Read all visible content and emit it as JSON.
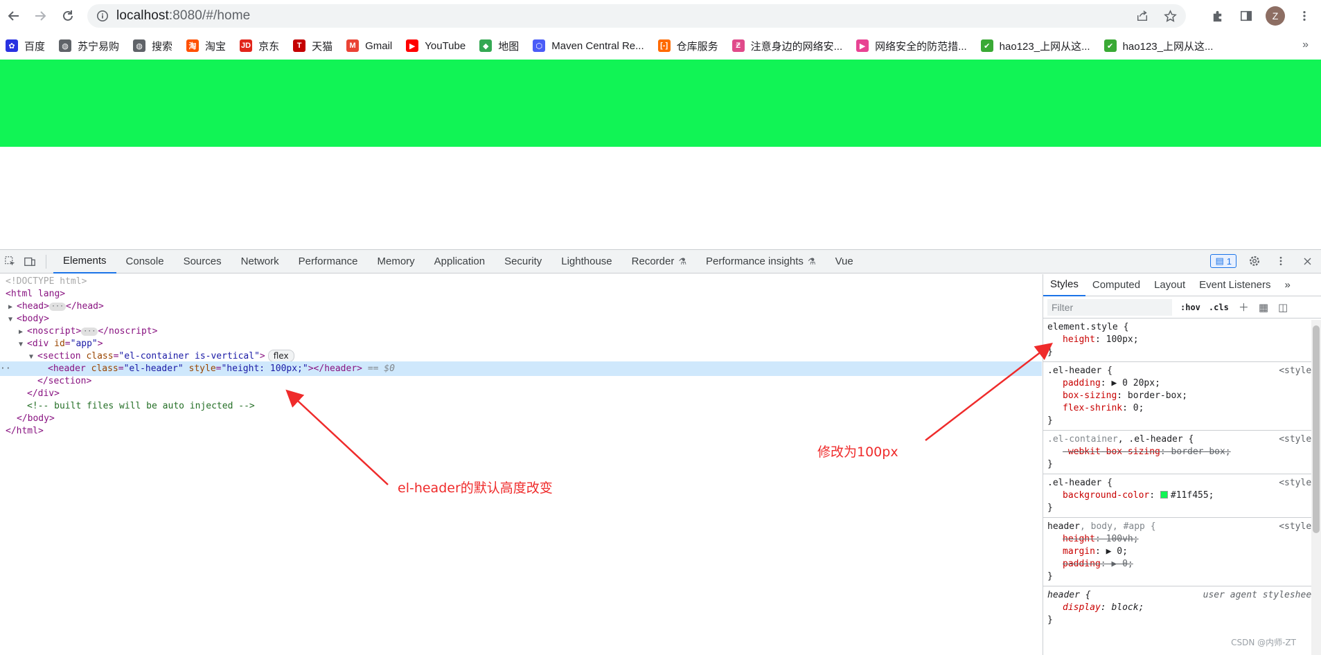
{
  "browser": {
    "url_host": "localhost",
    "url_rest": ":8080/#/home",
    "avatar_initial": "Z"
  },
  "bookmarks": [
    {
      "label": "百度",
      "icon": "baidu-icon",
      "color": "#2932e1",
      "glyph": "✿"
    },
    {
      "label": "苏宁易购",
      "icon": "globe-icon",
      "color": "#5f6368",
      "glyph": "◍"
    },
    {
      "label": "搜索",
      "icon": "globe-icon",
      "color": "#5f6368",
      "glyph": "◍"
    },
    {
      "label": "淘宝",
      "icon": "taobao-icon",
      "color": "#ff5000",
      "glyph": "淘"
    },
    {
      "label": "京东",
      "icon": "jd-icon",
      "color": "#e1251b",
      "glyph": "JD"
    },
    {
      "label": "天猫",
      "icon": "tmall-icon",
      "color": "#c40000",
      "glyph": "T"
    },
    {
      "label": "Gmail",
      "icon": "gmail-icon",
      "color": "#ea4335",
      "glyph": "M"
    },
    {
      "label": "YouTube",
      "icon": "youtube-icon",
      "color": "#ff0000",
      "glyph": "▶"
    },
    {
      "label": "地图",
      "icon": "maps-icon",
      "color": "#34a853",
      "glyph": "◆"
    },
    {
      "label": "Maven Central Re...",
      "icon": "maven-icon",
      "color": "#4a5cf7",
      "glyph": "⬡"
    },
    {
      "label": "仓库服务",
      "icon": "aliyun-icon",
      "color": "#ff6a00",
      "glyph": "[-]"
    },
    {
      "label": "注意身边的网络安...",
      "icon": "bilibili-icon",
      "color": "#e04a8a",
      "glyph": "Ƶ"
    },
    {
      "label": "网络安全的防范措...",
      "icon": "video-icon",
      "color": "#e84393",
      "glyph": "▶"
    },
    {
      "label": "hao123_上网从这...",
      "icon": "hao123-icon",
      "color": "#3aa935",
      "glyph": "✔"
    },
    {
      "label": "hao123_上网从这...",
      "icon": "hao123-icon",
      "color": "#3aa935",
      "glyph": "✔"
    }
  ],
  "bookmarks_more": "»",
  "header_color": "#11f455",
  "devtools": {
    "tabs": [
      {
        "label": "Elements",
        "active": true,
        "flask": false
      },
      {
        "label": "Console",
        "active": false,
        "flask": false
      },
      {
        "label": "Sources",
        "active": false,
        "flask": false
      },
      {
        "label": "Network",
        "active": false,
        "flask": false
      },
      {
        "label": "Performance",
        "active": false,
        "flask": false
      },
      {
        "label": "Memory",
        "active": false,
        "flask": false
      },
      {
        "label": "Application",
        "active": false,
        "flask": false
      },
      {
        "label": "Security",
        "active": false,
        "flask": false
      },
      {
        "label": "Lighthouse",
        "active": false,
        "flask": false
      },
      {
        "label": "Recorder",
        "active": false,
        "flask": true
      },
      {
        "label": "Performance insights",
        "active": false,
        "flask": true
      },
      {
        "label": "Vue",
        "active": false,
        "flask": false
      }
    ],
    "issues_count": "1",
    "dom": {
      "doctype": "<!DOCTYPE html>",
      "html_open": "<html lang>",
      "head": "<head>",
      "head_close": "</head>",
      "body_open": "<body>",
      "noscript": "<noscript>",
      "noscript_close": "</noscript>",
      "div_app_tag": "<div ",
      "div_app_attr": "id",
      "div_app_val": "\"app\"",
      "section_tag": "<section ",
      "section_attr": "class",
      "section_val": "\"el-container is-vertical\"",
      "flex_badge": "flex",
      "header_tag": "<header ",
      "header_attr1": "class",
      "header_val1": "\"el-header\"",
      "header_attr2": "style",
      "header_val2": "\"height: 100px;\"",
      "header_close": "></header>",
      "dollar": " == $0",
      "section_close": "</section>",
      "div_close": "</div>",
      "comment": "<!-- built files will be auto injected -->",
      "body_close": "</body>",
      "html_close": "</html>"
    },
    "styles_tabs": [
      "Styles",
      "Computed",
      "Layout",
      "Event Listeners"
    ],
    "styles_more": "»",
    "filter_placeholder": "Filter",
    "hov": ":hov",
    "cls": ".cls",
    "rules": {
      "r1_selector": "element.style {",
      "r1_prop": "height",
      "r1_val": ": 100px;",
      "r2_selector": ".el-header {",
      "r2_src": "<style>",
      "r2_p1": "padding",
      "r2_v1": ": ▶ 0 20px;",
      "r2_p2": "box-sizing",
      "r2_v2": ": border-box;",
      "r2_p3": "flex-shrink",
      "r2_v3": ": 0;",
      "r3_selector_a": ".el-container",
      "r3_selector_b": ", .el-header {",
      "r3_src": "<style>",
      "r3_p1": "-webkit-box-sizing",
      "r3_v1": ": border-box;",
      "r4_selector": ".el-header {",
      "r4_src": "<style>",
      "r4_p1": "background-color",
      "r4_v1": "#11f455;",
      "r5_selector_a": "header",
      "r5_selector_b": ", body, #app {",
      "r5_src": "<style>",
      "r5_p1": "height",
      "r5_v1": ": 100vh;",
      "r5_p2": "margin",
      "r5_v2": ": ▶ 0;",
      "r5_p3": "padding",
      "r5_v3": ": ▶ 0;",
      "r6_selector": "header {",
      "r6_src": "user agent stylesheet",
      "r6_p1": "display",
      "r6_v1": ": block;",
      "close": "}"
    }
  },
  "annotations": {
    "left": "el-header的默认高度改变",
    "right": "修改为100px"
  },
  "watermark": "CSDN @内师-ZT"
}
